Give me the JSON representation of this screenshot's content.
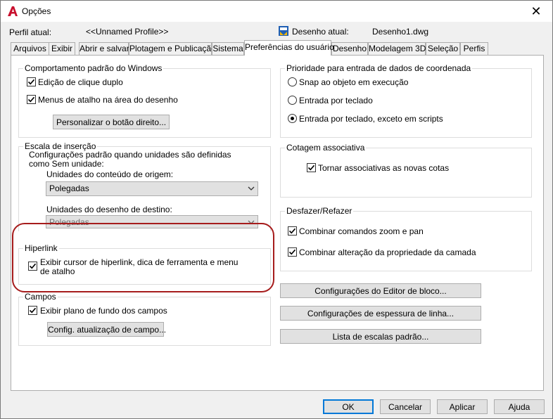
{
  "window": {
    "title": "Opções",
    "close_glyph": "✕",
    "app_icon": "autocad-a-icon",
    "accent": "#0078d7",
    "highlight_color": "#a61c1c"
  },
  "profile": {
    "label": "Perfil atual:",
    "value": "<<Unnamed Profile>>",
    "drawing_label": "Desenho atual:",
    "drawing_value": "Desenho1.dwg"
  },
  "tabs": [
    {
      "label": "Arquivos"
    },
    {
      "label": "Exibir"
    },
    {
      "label": "Abrir e salvar"
    },
    {
      "label": "Plotagem e Publicação"
    },
    {
      "label": "Sistema"
    },
    {
      "label": "Preferências do usuário",
      "active": true
    },
    {
      "label": "Desenho"
    },
    {
      "label": "Modelagem 3D"
    },
    {
      "label": "Seleção"
    },
    {
      "label": "Perfis"
    }
  ],
  "windows_behavior": {
    "title": "Comportamento padrão do Windows",
    "double_click": {
      "label": "Edição de clique duplo",
      "checked": true
    },
    "shortcut_menus": {
      "label": "Menus de atalho na área do desenho",
      "checked": true
    },
    "right_click_button": "Personalizar o botão direito..."
  },
  "insertion_scale": {
    "title": "Escala de inserção",
    "description_line1": "Configurações padrão quando unidades são definidas",
    "description_line2": "como Sem unidade:",
    "source_label": "Unidades do conteúdo de origem:",
    "source_value": "Polegadas",
    "target_label": "Unidades do desenho de destino:",
    "target_value": "Polegadas"
  },
  "hyperlink": {
    "title": "Hiperlink",
    "display_label_line1": "Exibir cursor de hiperlink, dica de ferramenta e menu",
    "display_label_line2": "de atalho",
    "checked": true
  },
  "fields": {
    "title": "Campos",
    "background_label": "Exibir plano de fundo dos campos",
    "checked": true,
    "update_button": "Config. atualização de campo..."
  },
  "coordinate_priority": {
    "title": "Prioridade para entrada de dados de coordenada",
    "options": [
      {
        "label": "Snap ao objeto em execução",
        "selected": false
      },
      {
        "label": "Entrada por teclado",
        "selected": false
      },
      {
        "label": "Entrada por teclado, exceto em scripts",
        "selected": true
      }
    ]
  },
  "associative_dimensioning": {
    "title": "Cotagem associativa",
    "label": "Tornar associativas as novas cotas",
    "checked": true
  },
  "undo_redo": {
    "title": "Desfazer/Refazer",
    "zoom_pan": {
      "label": "Combinar comandos zoom e pan",
      "checked": true
    },
    "layer_props": {
      "label": "Combinar alteração da propriedade da camada",
      "checked": true
    }
  },
  "right_buttons": {
    "block_editor": "Configurações do Editor de bloco...",
    "lineweight": "Configurações de espessura de linha...",
    "scale_list": "Lista de escalas padrão..."
  },
  "footer": {
    "ok": "OK",
    "cancel": "Cancelar",
    "apply": "Aplicar",
    "help": "Ajuda"
  }
}
